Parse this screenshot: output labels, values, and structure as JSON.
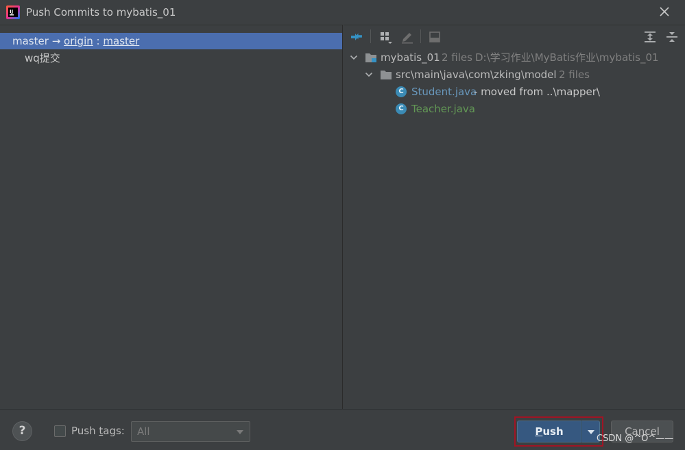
{
  "window": {
    "title": "Push Commits to mybatis_01"
  },
  "left_panel": {
    "branch": {
      "local": "master",
      "arrow": "→",
      "remote": "origin",
      "separator": ":",
      "remote_branch": "master"
    },
    "commits": [
      {
        "message": "wq提交"
      }
    ]
  },
  "right_panel": {
    "toolbar": {
      "icons": [
        "compare-icon",
        "group-by-icon",
        "edit-icon",
        "show-diff-icon",
        "expand-all-icon",
        "collapse-all-icon"
      ]
    },
    "tree": {
      "root": {
        "name": "mybatis_01",
        "count": "2 files",
        "path": "D:\\学习作业\\MyBatis作业\\mybatis_01"
      },
      "folder": {
        "name": "src\\main\\java\\com\\zking\\model",
        "count": "2 files"
      },
      "files": [
        {
          "name": "Student.java",
          "note": " - moved from ..\\mapper\\",
          "status": "modified",
          "color": "#6897bb"
        },
        {
          "name": "Teacher.java",
          "note": "",
          "status": "added",
          "color": "#629755"
        }
      ]
    }
  },
  "footer": {
    "help_label": "?",
    "push_tags_label_prefix": "Push ",
    "push_tags_label_mnemonic": "t",
    "push_tags_label_suffix": "ags:",
    "tags_select_value": "All",
    "push_label_mnemonic": "P",
    "push_label_rest": "ush",
    "cancel_label_prefix": "Ca",
    "cancel_label_mnemonic": "n",
    "cancel_label_suffix": "cel",
    "watermark": "CSDN @^O^——"
  },
  "colors": {
    "selection": "#4b6eaf",
    "modified_file": "#6897bb",
    "added_file": "#629755",
    "push_highlight": "#a01424"
  }
}
